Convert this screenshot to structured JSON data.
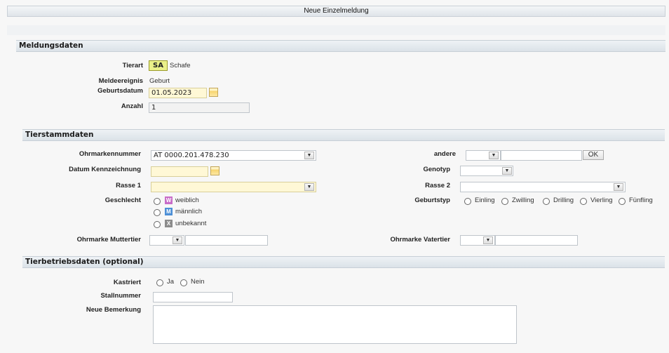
{
  "window": {
    "title": "Neue Einzelmeldung"
  },
  "meldungsdaten": {
    "header": "Meldungsdaten",
    "tierart_label": "Tierart",
    "tierart_code": "SA",
    "tierart_name": "Schafe",
    "meldeereignis_label": "Meldeereignis",
    "meldeereignis_value": "Geburt",
    "geburtsdatum_label": "Geburtsdatum",
    "geburtsdatum_value": "01.05.2023",
    "anzahl_label": "Anzahl",
    "anzahl_value": "1"
  },
  "tierstammdaten": {
    "header": "Tierstammdaten",
    "ohrmarkennummer_label": "Ohrmarkennummer",
    "ohrmarkennummer_value": "AT 0000.201.478.230",
    "andere_label": "andere",
    "ok_label": "OK",
    "datum_kennzeichnung_label": "Datum Kennzeichnung",
    "genotyp_label": "Genotyp",
    "rasse1_label": "Rasse 1",
    "rasse2_label": "Rasse 2",
    "geschlecht_label": "Geschlecht",
    "geschlecht_options": [
      {
        "code": "W",
        "label": "weiblich",
        "color": "#c86cc8"
      },
      {
        "code": "M",
        "label": "männlich",
        "color": "#4d8fd6"
      },
      {
        "code": "X",
        "label": "unbekannt",
        "color": "#8c8c8c"
      }
    ],
    "geburtstyp_label": "Geburtstyp",
    "geburtstyp_options": [
      "Einling",
      "Zwilling",
      "Drilling",
      "Vierling",
      "Fünfling"
    ],
    "ohrmarke_muttertier_label": "Ohrmarke Muttertier",
    "ohrmarke_vatertier_label": "Ohrmarke Vatertier"
  },
  "tierbetriebsdaten": {
    "header": "Tierbetriebsdaten (optional)",
    "kastriert_label": "Kastriert",
    "kastriert_options": [
      "Ja",
      "Nein"
    ],
    "stallnummer_label": "Stallnummer",
    "bemerkung_label": "Neue Bemerkung"
  }
}
